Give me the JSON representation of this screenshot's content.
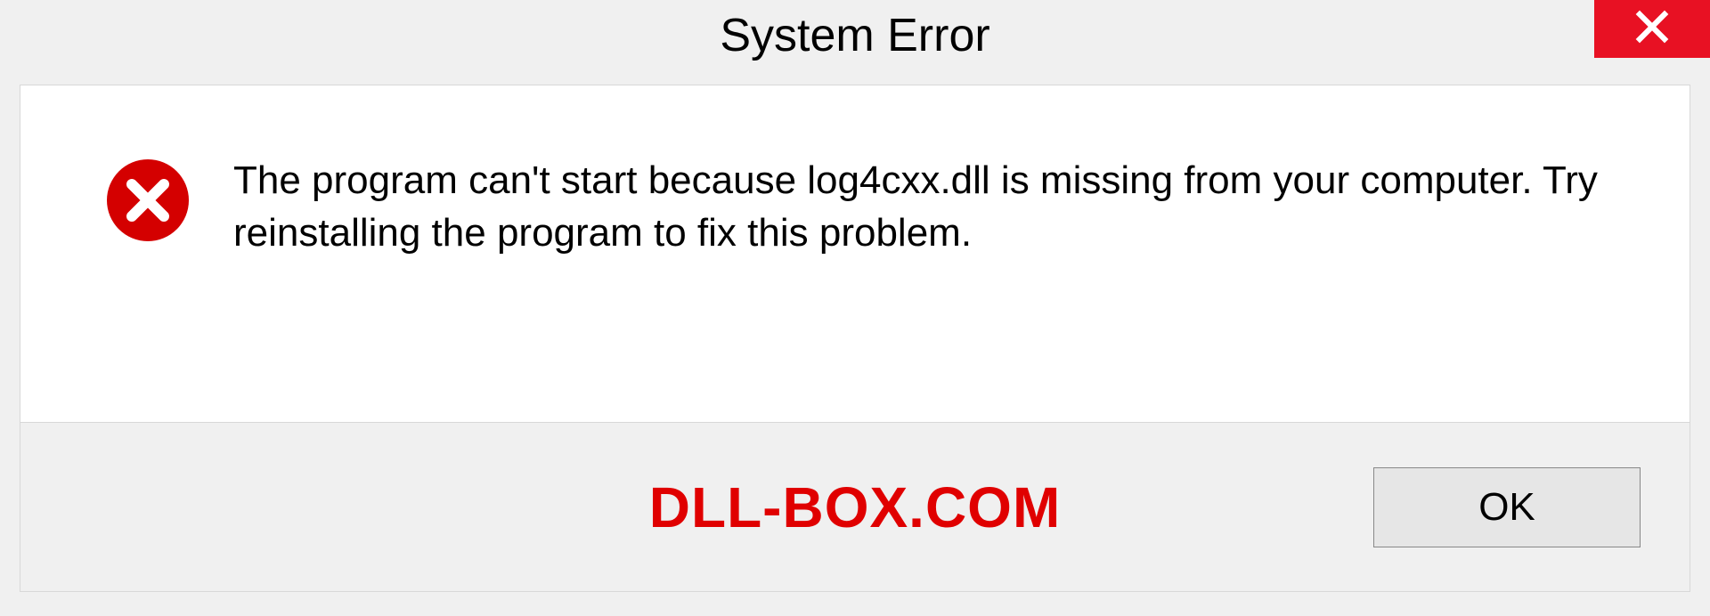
{
  "titlebar": {
    "title": "System Error"
  },
  "dialog": {
    "message": "The program can't start because log4cxx.dll is missing from your computer. Try reinstalling the program to fix this problem."
  },
  "footer": {
    "watermark": "DLL-BOX.COM",
    "ok_label": "OK"
  },
  "colors": {
    "close_bg": "#e81123",
    "error_icon": "#d40000",
    "watermark": "#e00000"
  }
}
